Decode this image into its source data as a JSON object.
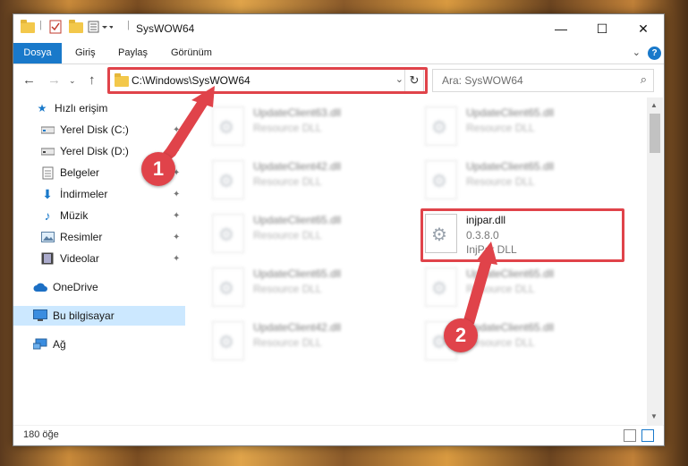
{
  "window": {
    "title": "SysWOW64"
  },
  "ribbon": {
    "tabs": [
      "Dosya",
      "Giriş",
      "Paylaş",
      "Görünüm"
    ],
    "help": "?"
  },
  "nav": {
    "address": "C:\\Windows\\SysWOW64",
    "search_placeholder": "Ara: SysWOW64"
  },
  "sidebar": {
    "items": [
      {
        "label": "Hızlı erişim",
        "icon": "star-icon"
      },
      {
        "label": "Yerel Disk (C:)",
        "icon": "drive-icon"
      },
      {
        "label": "Yerel Disk (D:)",
        "icon": "drive-icon"
      },
      {
        "label": "Belgeler",
        "icon": "documents-icon"
      },
      {
        "label": "İndirmeler",
        "icon": "download-icon"
      },
      {
        "label": "Müzik",
        "icon": "music-icon"
      },
      {
        "label": "Resimler",
        "icon": "pictures-icon"
      },
      {
        "label": "Videolar",
        "icon": "videos-icon"
      },
      {
        "label": "OneDrive",
        "icon": "cloud-icon"
      },
      {
        "label": "Bu bilgisayar",
        "icon": "computer-icon"
      },
      {
        "label": "Ağ",
        "icon": "network-icon"
      }
    ],
    "selected": "Bu bilgisayar"
  },
  "files": [
    {
      "name": "UpdateClient63.dll",
      "line2": "Resource DLL"
    },
    {
      "name": "UpdateClient65.dll",
      "line2": "Resource DLL"
    },
    {
      "name": "UpdateClient42.dll",
      "line2": "Resource DLL"
    },
    {
      "name": "UpdateClient65.dll",
      "line2": "Resource DLL"
    },
    {
      "name": "UpdateClient65.dll",
      "line2": "Resource DLL"
    },
    {
      "name": "injpar.dll",
      "line2": "0.3.8.0",
      "line3": "InjPar DLL"
    },
    {
      "name": "UpdateClient65.dll",
      "line2": "Resource DLL"
    },
    {
      "name": "UpdateClient65.dll",
      "line2": "Resource DLL"
    },
    {
      "name": "UpdateClient42.dll",
      "line2": "Resource DLL"
    },
    {
      "name": "UpdateClient65.dll",
      "line2": "Resource DLL"
    }
  ],
  "status": {
    "count": "180 öğe"
  },
  "callouts": [
    "1",
    "2"
  ],
  "colors": {
    "accent": "#1979ca",
    "highlight": "#e0434a",
    "selection": "#cce8ff"
  }
}
